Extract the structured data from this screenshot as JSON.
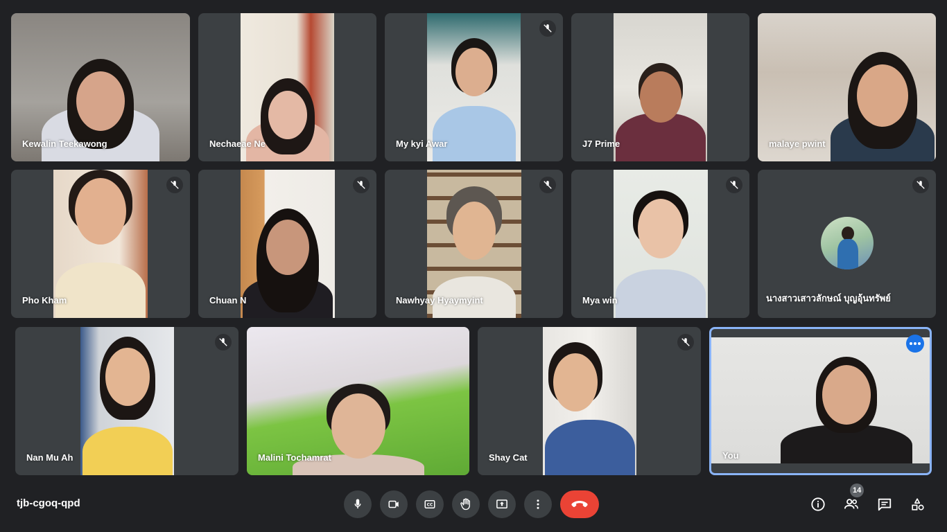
{
  "meeting": {
    "code": "tjb-cgoq-qpd",
    "participant_count": "14"
  },
  "participants": [
    {
      "name": "Kewalin Teekawong",
      "muted": false
    },
    {
      "name": "Nechaeae Ne",
      "muted": false
    },
    {
      "name": "My kyi Awar",
      "muted": true
    },
    {
      "name": "J7 Prime",
      "muted": false
    },
    {
      "name": "malaye pwint",
      "muted": false
    },
    {
      "name": "Pho Kham",
      "muted": true
    },
    {
      "name": "Chuan N",
      "muted": true
    },
    {
      "name": "Nawhyay Hyaymyint",
      "muted": true
    },
    {
      "name": "Mya win",
      "muted": true
    },
    {
      "name": "นางสาวเสาวลักษณ์ บุญอุ้นทรัพย์",
      "muted": true
    },
    {
      "name": "Nan Mu Ah",
      "muted": true
    },
    {
      "name": "Malini Tochamrat",
      "muted": false
    },
    {
      "name": "Shay Cat",
      "muted": true
    },
    {
      "name": "You",
      "muted": false
    }
  ],
  "controls": {
    "microphone": "microphone-icon",
    "camera": "camera-icon",
    "captions": "captions-icon",
    "raise_hand": "hand-icon",
    "present": "present-screen-icon",
    "more_options": "more-vert-icon",
    "leave_call": "end-call-icon"
  },
  "right_controls": {
    "info": "info-icon",
    "people": "people-icon",
    "chat": "chat-icon",
    "activities": "activities-icon"
  },
  "colors": {
    "background": "#202124",
    "tile": "#3c4043",
    "end_call": "#ea4335",
    "self_border": "#8ab4f8",
    "more_button": "#1a73e8"
  }
}
